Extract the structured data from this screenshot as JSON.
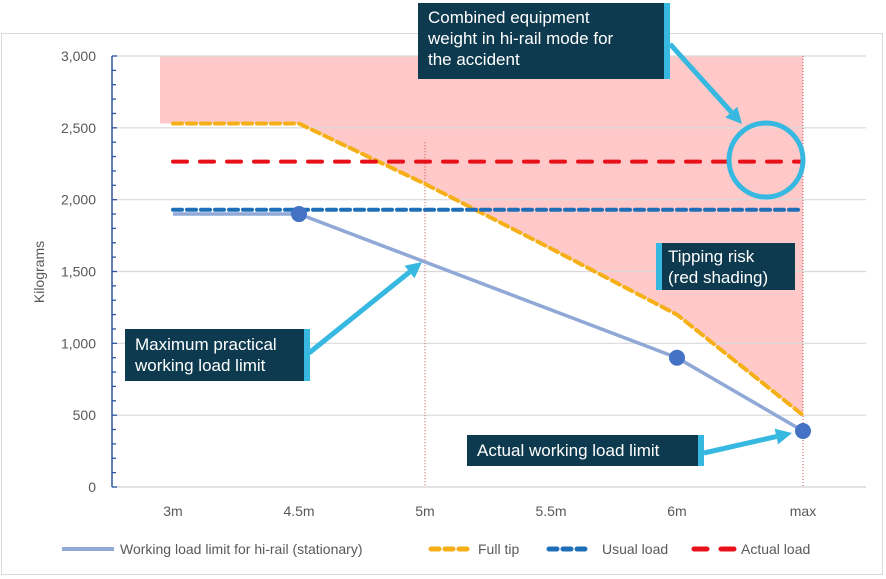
{
  "chart_data": {
    "type": "line",
    "title": "",
    "xlabel": "",
    "ylabel": "Kilograms",
    "categories": [
      "3m",
      "4.5m",
      "5m",
      "5.5m",
      "6m",
      "max"
    ],
    "ylim": [
      0,
      3000
    ],
    "yticks": [
      0,
      500,
      1000,
      1500,
      2000,
      2500,
      3000
    ],
    "ytick_labels": [
      "0",
      "500",
      "1,000",
      "1,500",
      "2,000",
      "2,500",
      "3,000"
    ],
    "grid": true,
    "legend_position": "bottom",
    "series": [
      {
        "name": "Working load limit for hi-rail (stationary)",
        "style": "solid",
        "color": "#8fa8d6",
        "marker_color": "#4472c4",
        "values": [
          1900,
          1900,
          1570,
          1235,
          900,
          390
        ],
        "markers_at": [
          1,
          4,
          5
        ]
      },
      {
        "name": "Full tip",
        "style": "dashed",
        "color": "#f5b017",
        "values": [
          2530,
          2530,
          2110,
          1660,
          1200,
          500
        ]
      },
      {
        "name": "Usual load",
        "style": "dashed",
        "color": "#1f6fb8",
        "values": [
          1930,
          1930,
          1930,
          1930,
          1930,
          1930
        ]
      },
      {
        "name": "Actual load",
        "style": "dashed-wide",
        "color": "#e8101a",
        "values": [
          2265,
          2265,
          2265,
          2265,
          2265,
          2265
        ]
      }
    ],
    "shaded_region": {
      "label": "Tipping risk (red shading)",
      "color": "#ffc9c9",
      "upper": 3000,
      "lower_follows": "Full tip"
    },
    "reference_lines": [
      {
        "at_category": "5m",
        "color": "#c0504d",
        "style": "dotted"
      },
      {
        "at_category": "max",
        "color": "#c0504d",
        "style": "dotted"
      }
    ],
    "annotations": [
      {
        "text": "Combined equipment weight in hi-rail mode for the accident",
        "points_to": "Actual load at max"
      },
      {
        "text": "Maximum practical working load limit",
        "points_to": "Working load limit at 5m"
      },
      {
        "text": "Tipping risk (red shading)",
        "points_to": "shaded region"
      },
      {
        "text": "Actual working load limit",
        "points_to": "Working load limit at max"
      }
    ]
  },
  "callouts": {
    "combined": [
      "Combined equipment",
      "weight in hi-rail  mode for",
      "the accident"
    ],
    "max_practical": [
      "Maximum practical",
      "working load limit"
    ],
    "tipping": [
      "Tipping risk",
      "(red shading)"
    ],
    "actual_wll": "Actual working load limit"
  },
  "colors": {
    "callout_bg": "#0e3a4f",
    "callout_accent": "#36b8e0",
    "axis": "#2f55a4",
    "grid": "#d9d9d9"
  }
}
